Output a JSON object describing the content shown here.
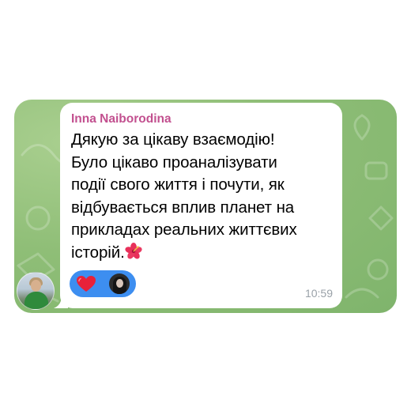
{
  "message": {
    "sender": "Inna Naiborodina",
    "lines": [
      "Дякую за цікаву взаємодію!",
      "Було цікаво проаналізувати",
      "події свого життя і почути, як",
      "відбувається вплив планет на",
      "прикладах реальних життєвих",
      "історій."
    ],
    "emoji": "hibiscus-icon",
    "time": "10:59"
  },
  "reactions": [
    {
      "icon": "red-heart-icon"
    },
    {
      "icon": "reactor-avatar"
    }
  ],
  "colors": {
    "sender_name": "#c2508f",
    "reaction_pill": "#3d8ef0",
    "chat_background": "#8fbe77",
    "bubble": "#ffffff",
    "time": "#9aa1a8"
  }
}
